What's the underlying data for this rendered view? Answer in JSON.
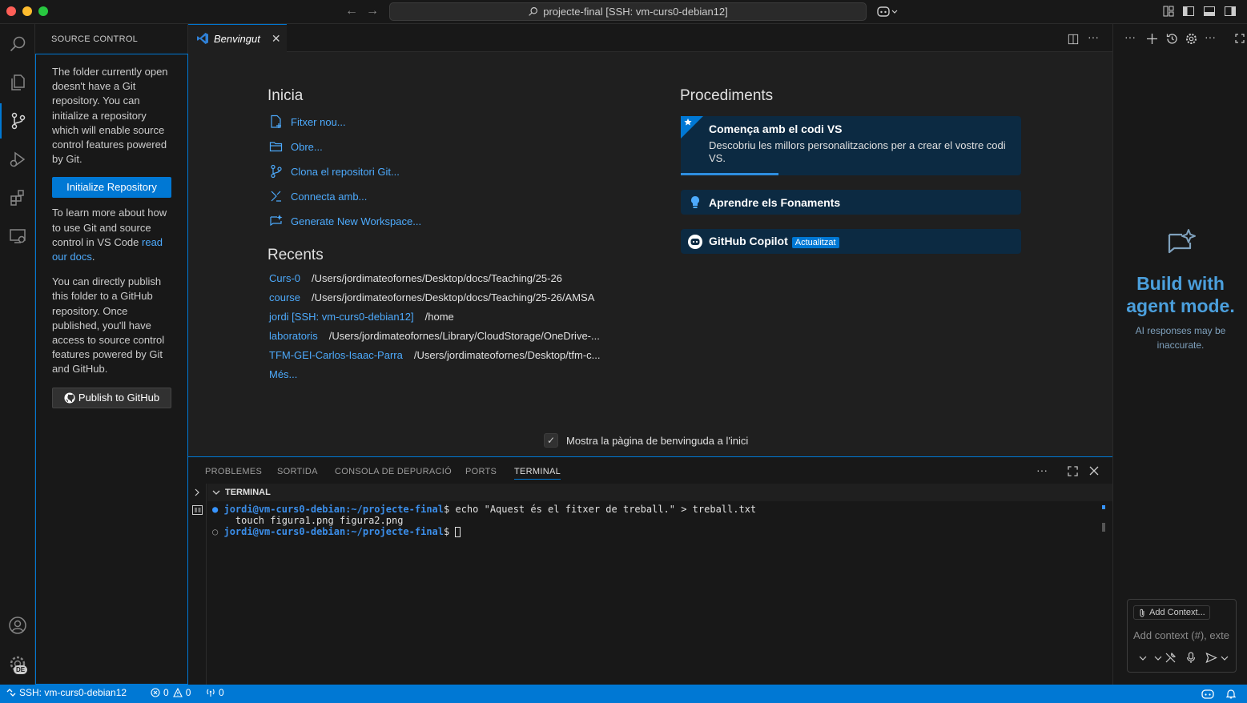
{
  "titlebar": {
    "command_center": "projecte-final [SSH: vm-curs0-debian12]"
  },
  "sidebar": {
    "header": "SOURCE CONTROL",
    "msg1": "The folder currently open doesn't have a Git repository. You can initialize a repository which will enable source control features powered by Git.",
    "init_button": "Initialize Repository",
    "msg2_prefix": "To learn more about how to use Git and source control in VS Code ",
    "msg2_link": "read our docs",
    "msg2_suffix": ".",
    "msg3": "You can directly publish this folder to a GitHub repository. Once published, you'll have access to source control features powered by Git and GitHub.",
    "publish_button": "Publish to GitHub"
  },
  "activitybar": {
    "locale_badge": "DE"
  },
  "tab": {
    "label": "Benvingut",
    "close": "✕"
  },
  "welcome": {
    "start_title": "Inicia",
    "start_items": [
      "Fitxer nou...",
      "Obre...",
      "Clona el repositori Git...",
      "Connecta amb...",
      "Generate New Workspace..."
    ],
    "recent_title": "Recents",
    "recents": [
      {
        "name": "Curs-0",
        "path": "/Users/jordimateofornes/Desktop/docs/Teaching/25-26"
      },
      {
        "name": "course",
        "path": "/Users/jordimateofornes/Desktop/docs/Teaching/25-26/AMSA"
      },
      {
        "name": "jordi [SSH: vm-curs0-debian12]",
        "path": "/home"
      },
      {
        "name": "laboratoris",
        "path": "/Users/jordimateofornes/Library/CloudStorage/OneDrive-..."
      },
      {
        "name": "TFM-GEI-Carlos-Isaac-Parra",
        "path": "/Users/jordimateofornes/Desktop/tfm-c..."
      }
    ],
    "more": "Més...",
    "walk_title": "Procediments",
    "walk1_title": "Comença amb el codi VS",
    "walk1_desc": "Descobriu les millors personalitzacions per a crear el vostre codi VS.",
    "walk2_title": "Aprendre els Fonaments",
    "walk3_title": "GitHub Copilot",
    "walk3_badge": "Actualitzat",
    "show_on_startup": "Mostra la pàgina de benvinguda a l'inici"
  },
  "panel": {
    "tabs": [
      "PROBLEMES",
      "SORTIDA",
      "CONSOLA DE DEPURACIÓ",
      "PORTS",
      "TERMINAL"
    ],
    "active_tab": "TERMINAL",
    "terminal_header": "TERMINAL",
    "line1_prompt": "jordi@vm-curs0-debian:~/projecte-final",
    "line1_cmd": "$ echo \"Aquest és el fitxer de treball.\" > treball.txt",
    "line2": "    touch figura1.png figura2.png",
    "line3_prompt": "jordi@vm-curs0-debian:~/projecte-final",
    "line3_cmd": "$ "
  },
  "chat": {
    "title": "Build with agent mode.",
    "subtitle": "AI responses may be inaccurate.",
    "add_context": "Add Context...",
    "placeholder": "Add context (#), exte"
  },
  "statusbar": {
    "remote": "SSH: vm-curs0-debian12",
    "errors": "0",
    "warnings": "0",
    "ports": "0"
  },
  "colors": {
    "accent": "#0078d4",
    "link": "#4daafc",
    "background": "#1f1f1f",
    "sidebar": "#181818"
  }
}
